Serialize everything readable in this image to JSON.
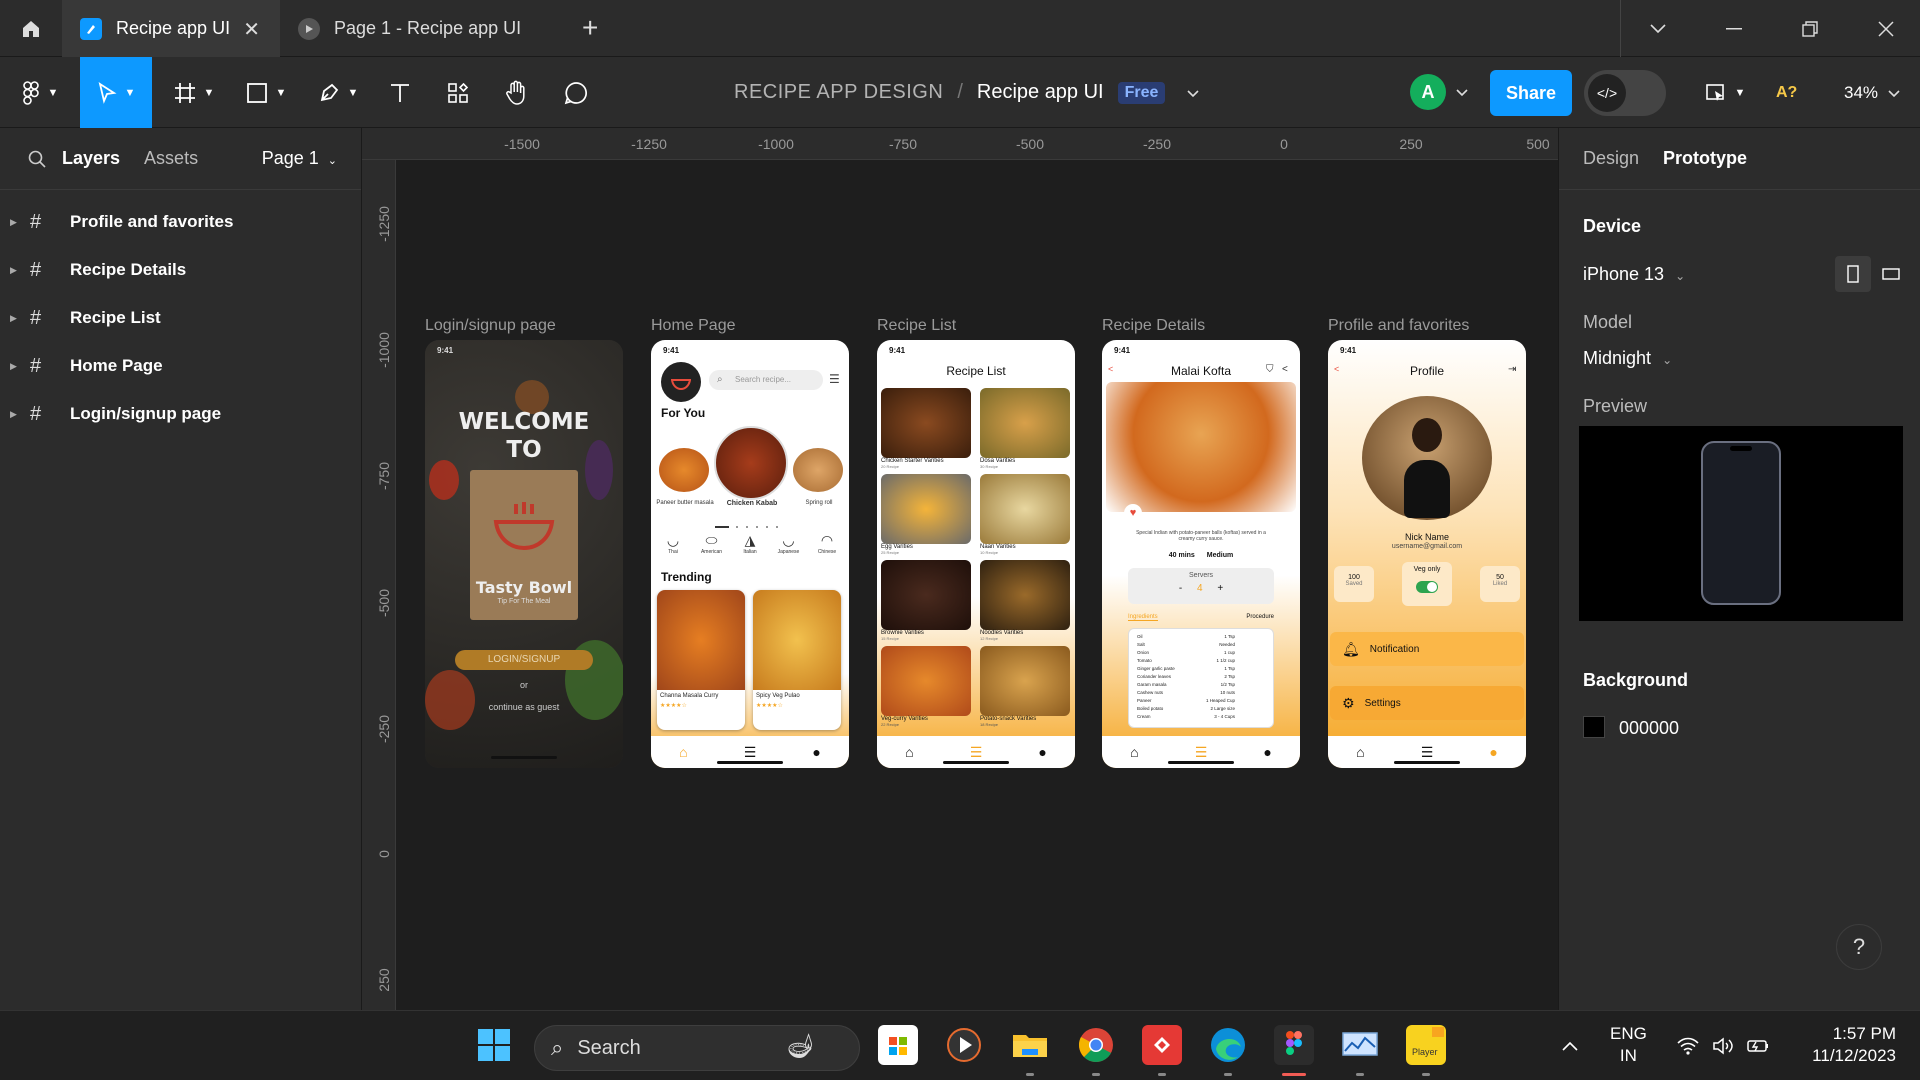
{
  "tabs": [
    {
      "label": "Recipe app UI",
      "active": true
    },
    {
      "label": "Page 1 - Recipe app UI",
      "active": false
    }
  ],
  "toolbar": {
    "project": "RECIPE APP DESIGN",
    "separator": "/",
    "file": "Recipe app UI",
    "plan_badge": "Free",
    "avatar_initial": "A",
    "share_label": "Share",
    "accessibility_label": "A?",
    "zoom": "34%"
  },
  "left_panel": {
    "tab_layers": "Layers",
    "tab_assets": "Assets",
    "page_selector": "Page 1",
    "layers": [
      {
        "name": "Profile and favorites"
      },
      {
        "name": "Recipe Details"
      },
      {
        "name": "Recipe List"
      },
      {
        "name": "Home Page"
      },
      {
        "name": "Login/signup page"
      }
    ]
  },
  "canvas": {
    "ruler_top": [
      "-1500",
      "-1250",
      "-1000",
      "-750",
      "-500",
      "-250",
      "0",
      "250",
      "500"
    ],
    "ruler_left": [
      "-1250",
      "-1000",
      "-750",
      "-500",
      "-250",
      "0",
      "250"
    ],
    "frames": [
      {
        "label": "Login/signup page",
        "time": "9:41",
        "welcome_line1": "WELCOME",
        "welcome_line2": "TO",
        "brand": "Tasty Bowl",
        "tagline": "Tip For The Meal",
        "login_button": "LOGIN/SIGNUP",
        "or_text": "or",
        "guest_text": "continue as guest"
      },
      {
        "label": "Home Page",
        "time": "9:41",
        "search_placeholder": "Search recipe...",
        "section_for_you": "For You",
        "for_you_items": [
          "Paneer butter masala",
          "Chicken Kabab",
          "Spring roll"
        ],
        "categories": [
          "Thai",
          "American",
          "Italian",
          "Japanese",
          "Chinese"
        ],
        "section_trending": "Trending",
        "trending_items": [
          "Channa Masala Curry",
          "Spicy Veg Pulao"
        ]
      },
      {
        "label": "Recipe List",
        "time": "9:41",
        "title": "Recipe List",
        "items": [
          {
            "name": "Chicken Starter Varities",
            "count": "20 Recipe"
          },
          {
            "name": "Dosa Varities",
            "count": "30 Recipe"
          },
          {
            "name": "Egg Varities",
            "count": "25 Recipe"
          },
          {
            "name": "Naan Varities",
            "count": "10 Recipe"
          },
          {
            "name": "Brownie Varities",
            "count": "15 Recipe"
          },
          {
            "name": "Noodles Varities",
            "count": "12 Recipe"
          },
          {
            "name": "Veg-curry Varities",
            "count": "22 Recipe"
          },
          {
            "name": "Potato-snack Varities",
            "count": "18 Recipe"
          }
        ]
      },
      {
        "label": "Recipe Details",
        "time": "9:41",
        "title": "Malai Kofta",
        "description": "Special Indian with potato-paneer balls (koftas) served in a creamy curry sauce.",
        "duration": "40 mins",
        "difficulty": "Medium",
        "servers_label": "Servers",
        "servers_minus": "-",
        "servers_value": "4",
        "servers_plus": "+",
        "tab_ingredients": "Ingredients",
        "tab_procedure": "Procedure",
        "ingredients": [
          {
            "name": "Oil",
            "qty": "1 Tsp"
          },
          {
            "name": "Salt",
            "qty": "Needed"
          },
          {
            "name": "Onion",
            "qty": "1 cup"
          },
          {
            "name": "Tomato",
            "qty": "1 1/2 cup"
          },
          {
            "name": "Ginger garlic paste",
            "qty": "1 Tsp"
          },
          {
            "name": "Coriander leaves",
            "qty": "2 Tsp"
          },
          {
            "name": "Garam masala",
            "qty": "1/2 Tsp"
          },
          {
            "name": "Cashew nuts",
            "qty": "10 nuts"
          },
          {
            "name": "Paneer",
            "qty": "1 Heaped Cup"
          },
          {
            "name": "Boiled potato",
            "qty": "2 Large size"
          },
          {
            "name": "Cream",
            "qty": "3 - 4 Cups"
          }
        ]
      },
      {
        "label": "Profile and favorites",
        "time": "9:41",
        "title": "Profile",
        "nick_name": "Nick Name",
        "email": "username@gmail.com",
        "saved_count": "100",
        "saved_label": "Saved",
        "veg_label": "Veg only",
        "liked_count": "50",
        "liked_label": "Liked",
        "menu_notification": "Notification",
        "menu_settings": "Settings"
      }
    ]
  },
  "right_panel": {
    "tab_design": "Design",
    "tab_prototype": "Prototype",
    "device_heading": "Device",
    "device_value": "iPhone 13",
    "model_label": "Model",
    "model_value": "Midnight",
    "preview_label": "Preview",
    "background_heading": "Background",
    "background_value": "000000",
    "help": "?"
  },
  "taskbar": {
    "search_label": "Search",
    "lang_line1": "ENG",
    "lang_line2": "IN",
    "time": "1:57 PM",
    "date": "11/12/2023"
  },
  "colors": {
    "accent_blue": "#0d99ff",
    "panel": "#2c2c2c",
    "canvas": "#1e1e1e",
    "recipe_orange": "#f5a623"
  }
}
